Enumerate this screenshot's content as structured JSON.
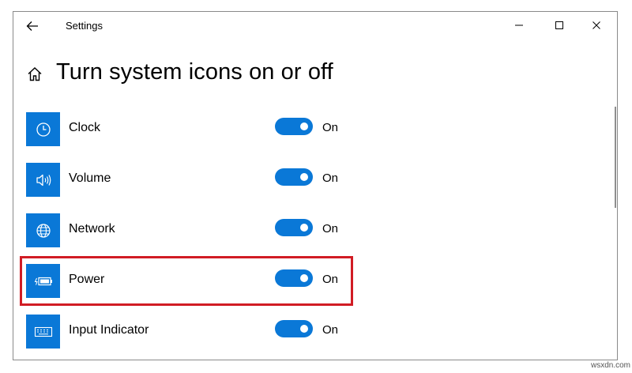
{
  "window": {
    "title": "Settings",
    "controls": [
      "minimize",
      "maximize",
      "close"
    ]
  },
  "page": {
    "title": "Turn system icons on or off"
  },
  "items": [
    {
      "label": "Clock",
      "icon": "clock-icon",
      "state": "On",
      "enabled": true
    },
    {
      "label": "Volume",
      "icon": "volume-icon",
      "state": "On",
      "enabled": true
    },
    {
      "label": "Network",
      "icon": "network-globe-icon",
      "state": "On",
      "enabled": true
    },
    {
      "label": "Power",
      "icon": "battery-power-icon",
      "state": "On",
      "enabled": true,
      "highlighted": true
    },
    {
      "label": "Input Indicator",
      "icon": "keyboard-icon",
      "state": "On",
      "enabled": true
    }
  ],
  "colors": {
    "accent": "#0a78d7",
    "highlight_border": "#d11c24"
  },
  "watermark": "wsxdn.com"
}
